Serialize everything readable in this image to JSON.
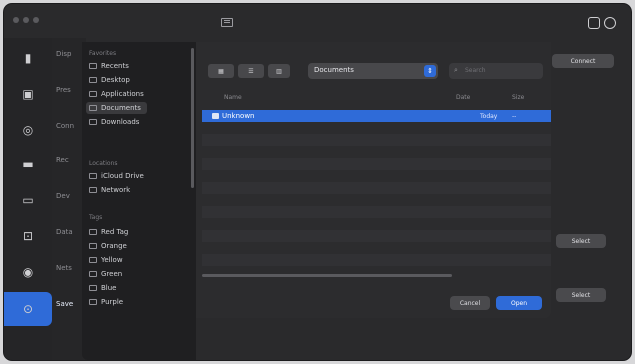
{
  "sidebar": {
    "favorites_header": "Favorites",
    "locations_header": "Locations",
    "tags_header": "Tags",
    "favorites": [
      "Recents",
      "Desktop",
      "Applications",
      "Documents",
      "Downloads"
    ],
    "locations": [
      "iCloud Drive",
      "Network"
    ],
    "tags": [
      "Red Tag",
      "Orange",
      "Yellow",
      "Green",
      "Blue",
      "Purple"
    ],
    "selected_index": 3
  },
  "dialog": {
    "segments": [
      "",
      "",
      ""
    ],
    "path_value": "Documents",
    "search_placeholder": "Search",
    "columns": [
      "Name",
      "Date",
      "Size"
    ],
    "rows": [
      {
        "name": "Unknown",
        "date": "Today",
        "size": "--"
      }
    ],
    "cancel_label": "Cancel",
    "open_label": "Open"
  },
  "right_panel": {
    "top_button": "Connect",
    "mid_button": "Select",
    "bottom_button": "Select"
  },
  "rail_labels": [
    "Disp",
    "Pres",
    "Conn",
    "Rec",
    "Dev",
    "Data",
    "Nets",
    "Save"
  ],
  "colors": {
    "accent": "#2f6bd8",
    "window": "#2a2a2c"
  }
}
